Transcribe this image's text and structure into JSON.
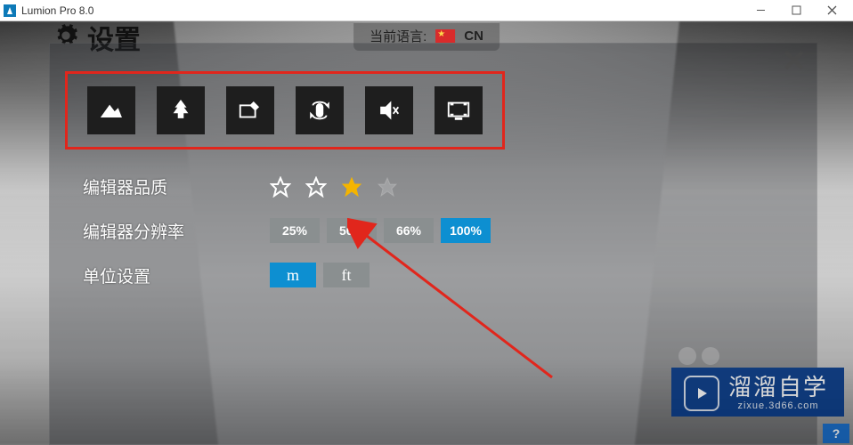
{
  "titlebar": {
    "title": "Lumion Pro 8.0"
  },
  "crumb": {
    "title": "设置"
  },
  "language": {
    "label": "当前语言:",
    "code": "CN"
  },
  "panel": {
    "icons": [
      {
        "name": "terrain-icon"
      },
      {
        "name": "tree-icon"
      },
      {
        "name": "tablet-edit-icon"
      },
      {
        "name": "mouse-rotate-icon"
      },
      {
        "name": "mute-icon"
      },
      {
        "name": "monitor-icon"
      }
    ],
    "quality": {
      "label": "编辑器品质",
      "stars": [
        "empty",
        "empty",
        "filled",
        "dim"
      ]
    },
    "resolution": {
      "label": "编辑器分辨率",
      "options": [
        {
          "label": "25%",
          "selected": false
        },
        {
          "label": "50%",
          "selected": false
        },
        {
          "label": "66%",
          "selected": false
        },
        {
          "label": "100%",
          "selected": true
        }
      ]
    },
    "units": {
      "label": "单位设置",
      "options": [
        {
          "label": "m",
          "selected": true
        },
        {
          "label": "ft",
          "selected": false
        }
      ]
    }
  },
  "watermark": {
    "brand": "溜溜自学",
    "site": "zixue.3d66.com"
  },
  "help": {
    "label": "?"
  }
}
